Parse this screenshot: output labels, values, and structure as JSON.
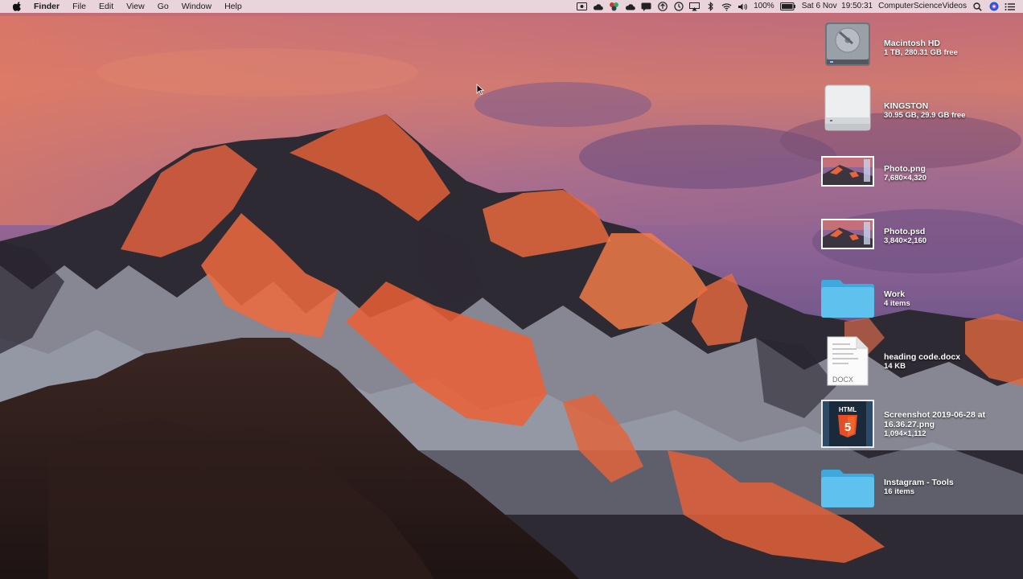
{
  "menubar": {
    "app_name": "Finder",
    "menus": [
      "File",
      "Edit",
      "View",
      "Go",
      "Window",
      "Help"
    ],
    "status_icons": [
      "screen-recorder-icon",
      "cloud-icon",
      "app-icon",
      "cloud-icon",
      "chat-icon",
      "upload-icon",
      "time-machine-icon",
      "airplay-icon",
      "bluetooth-icon",
      "wifi-icon",
      "volume-icon"
    ],
    "battery": "100%",
    "datetime": "Sat 6 Nov  19:50:31",
    "user": "ComputerScienceVideos",
    "accent": "#1f5bd8"
  },
  "desktop": {
    "items": [
      {
        "name": "Macintosh HD",
        "info": "1 TB, 280.31 GB free",
        "icon": "hard-drive-icon"
      },
      {
        "name": "KINGSTON",
        "info": "30.95 GB, 29.9 GB free",
        "icon": "external-drive-icon"
      },
      {
        "name": "Photo.png",
        "info": "7,680×4,320",
        "icon": "image-thumbnail-icon"
      },
      {
        "name": "Photo.psd",
        "info": "3,840×2,160",
        "icon": "image-thumbnail-icon"
      },
      {
        "name": "Work",
        "info": "4 items",
        "icon": "folder-icon"
      },
      {
        "name": "heading code.docx",
        "info": "14 KB",
        "icon": "docx-file-icon",
        "badge": "DOCX"
      },
      {
        "name": "Screenshot 2019-06-28 at",
        "name_line2": "16.36.27.png",
        "info": "1,094×1,112",
        "icon": "html5-screenshot-icon",
        "badge": "HTML"
      },
      {
        "name": "Instagram - Tools",
        "info": "16 items",
        "icon": "folder-icon"
      }
    ],
    "folder_color": "#5ec1ee",
    "html5_color": "#e44d26"
  }
}
